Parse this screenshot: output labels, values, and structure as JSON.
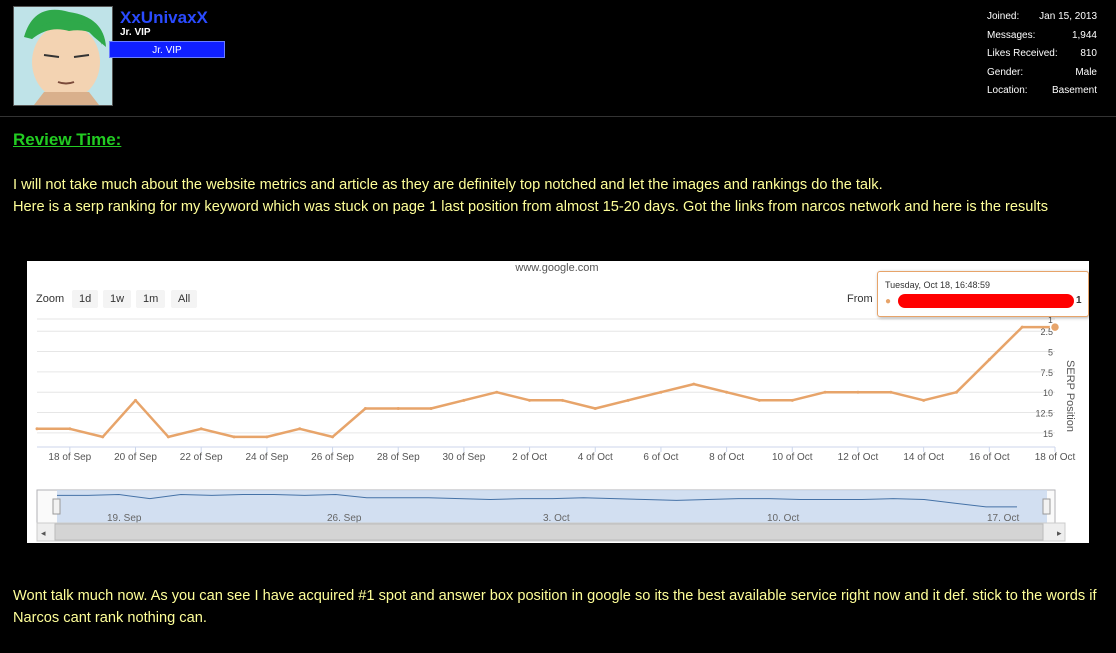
{
  "user": {
    "username": "XxUnivaxX",
    "title": "Jr. VIP",
    "banner": "Jr. VIP",
    "stats": [
      {
        "label": "Joined:",
        "value": "Jan 15, 2013"
      },
      {
        "label": "Messages:",
        "value": "1,944"
      },
      {
        "label": "Likes Received:",
        "value": "810"
      },
      {
        "label": "Gender:",
        "value": "Male"
      },
      {
        "label": "Location:",
        "value": "Basement"
      }
    ]
  },
  "post": {
    "heading": "Review Time:",
    "p1_line1": "I will not take much about the website metrics and article as they are definitely top notched and let the images and rankings do the talk.",
    "p1_line2": "Here is a serp ranking for my keyword which was stuck on page 1 last position from almost 15-20 days. Got the links from narcos network and here is the results",
    "p2": "Wont talk much now. As you can see I have acquired #1 spot and answer box position in google so its the best available service right now and it def. stick to the words if Narcos cant rank nothing can."
  },
  "colors": {
    "series": "#e7a46a",
    "heading": "#22cc22",
    "username": "#2a4bff",
    "text": "#ffff99"
  },
  "chart_data": {
    "type": "line",
    "title": "www.google.com",
    "ylabel": "SERP Position",
    "y_reversed": true,
    "ylim": [
      16,
      1
    ],
    "y_ticks": [
      "1",
      "2.5",
      "5",
      "7.5",
      "10",
      "12.5",
      "15"
    ],
    "x_ticks": [
      "18 of Sep",
      "20 of Sep",
      "22 of Sep",
      "24 of Sep",
      "26 of Sep",
      "28 of Sep",
      "30 of Sep",
      "2 of Oct",
      "4 of Oct",
      "6 of Oct",
      "8 of Oct",
      "10 of Oct",
      "12 of Oct",
      "14 of Oct",
      "16 of Oct",
      "18 of Oct"
    ],
    "zoom": {
      "label": "Zoom",
      "buttons": [
        "1d",
        "1w",
        "1m",
        "All"
      ]
    },
    "from_label": "From",
    "navigator_labels": [
      "19. Sep",
      "26. Sep",
      "3. Oct",
      "10. Oct",
      "17. Oct"
    ],
    "tooltip": {
      "title": "Tuesday, Oct 18, 16:48:59",
      "value": "1"
    },
    "series": [
      {
        "x": [
          "Sep 17",
          "Sep 18",
          "Sep 19",
          "Sep 20",
          "Sep 21",
          "Sep 22",
          "Sep 23",
          "Sep 24",
          "Sep 25",
          "Sep 26",
          "Sep 27",
          "Sep 28",
          "Sep 29",
          "Sep 30",
          "Oct 1",
          "Oct 2",
          "Oct 3",
          "Oct 4",
          "Oct 5",
          "Oct 6",
          "Oct 7",
          "Oct 8",
          "Oct 9",
          "Oct 10",
          "Oct 11",
          "Oct 12",
          "Oct 13",
          "Oct 14",
          "Oct 15",
          "Oct 16",
          "Oct 17",
          "Oct 18"
        ],
        "values": [
          14.5,
          14.5,
          15.5,
          11,
          15.5,
          14.5,
          15.5,
          15.5,
          14.5,
          15.5,
          12,
          12,
          12,
          11,
          10,
          11,
          11,
          12,
          11,
          10,
          9,
          10,
          11,
          11,
          10,
          10,
          10,
          11,
          10,
          6,
          2,
          2
        ]
      }
    ]
  }
}
